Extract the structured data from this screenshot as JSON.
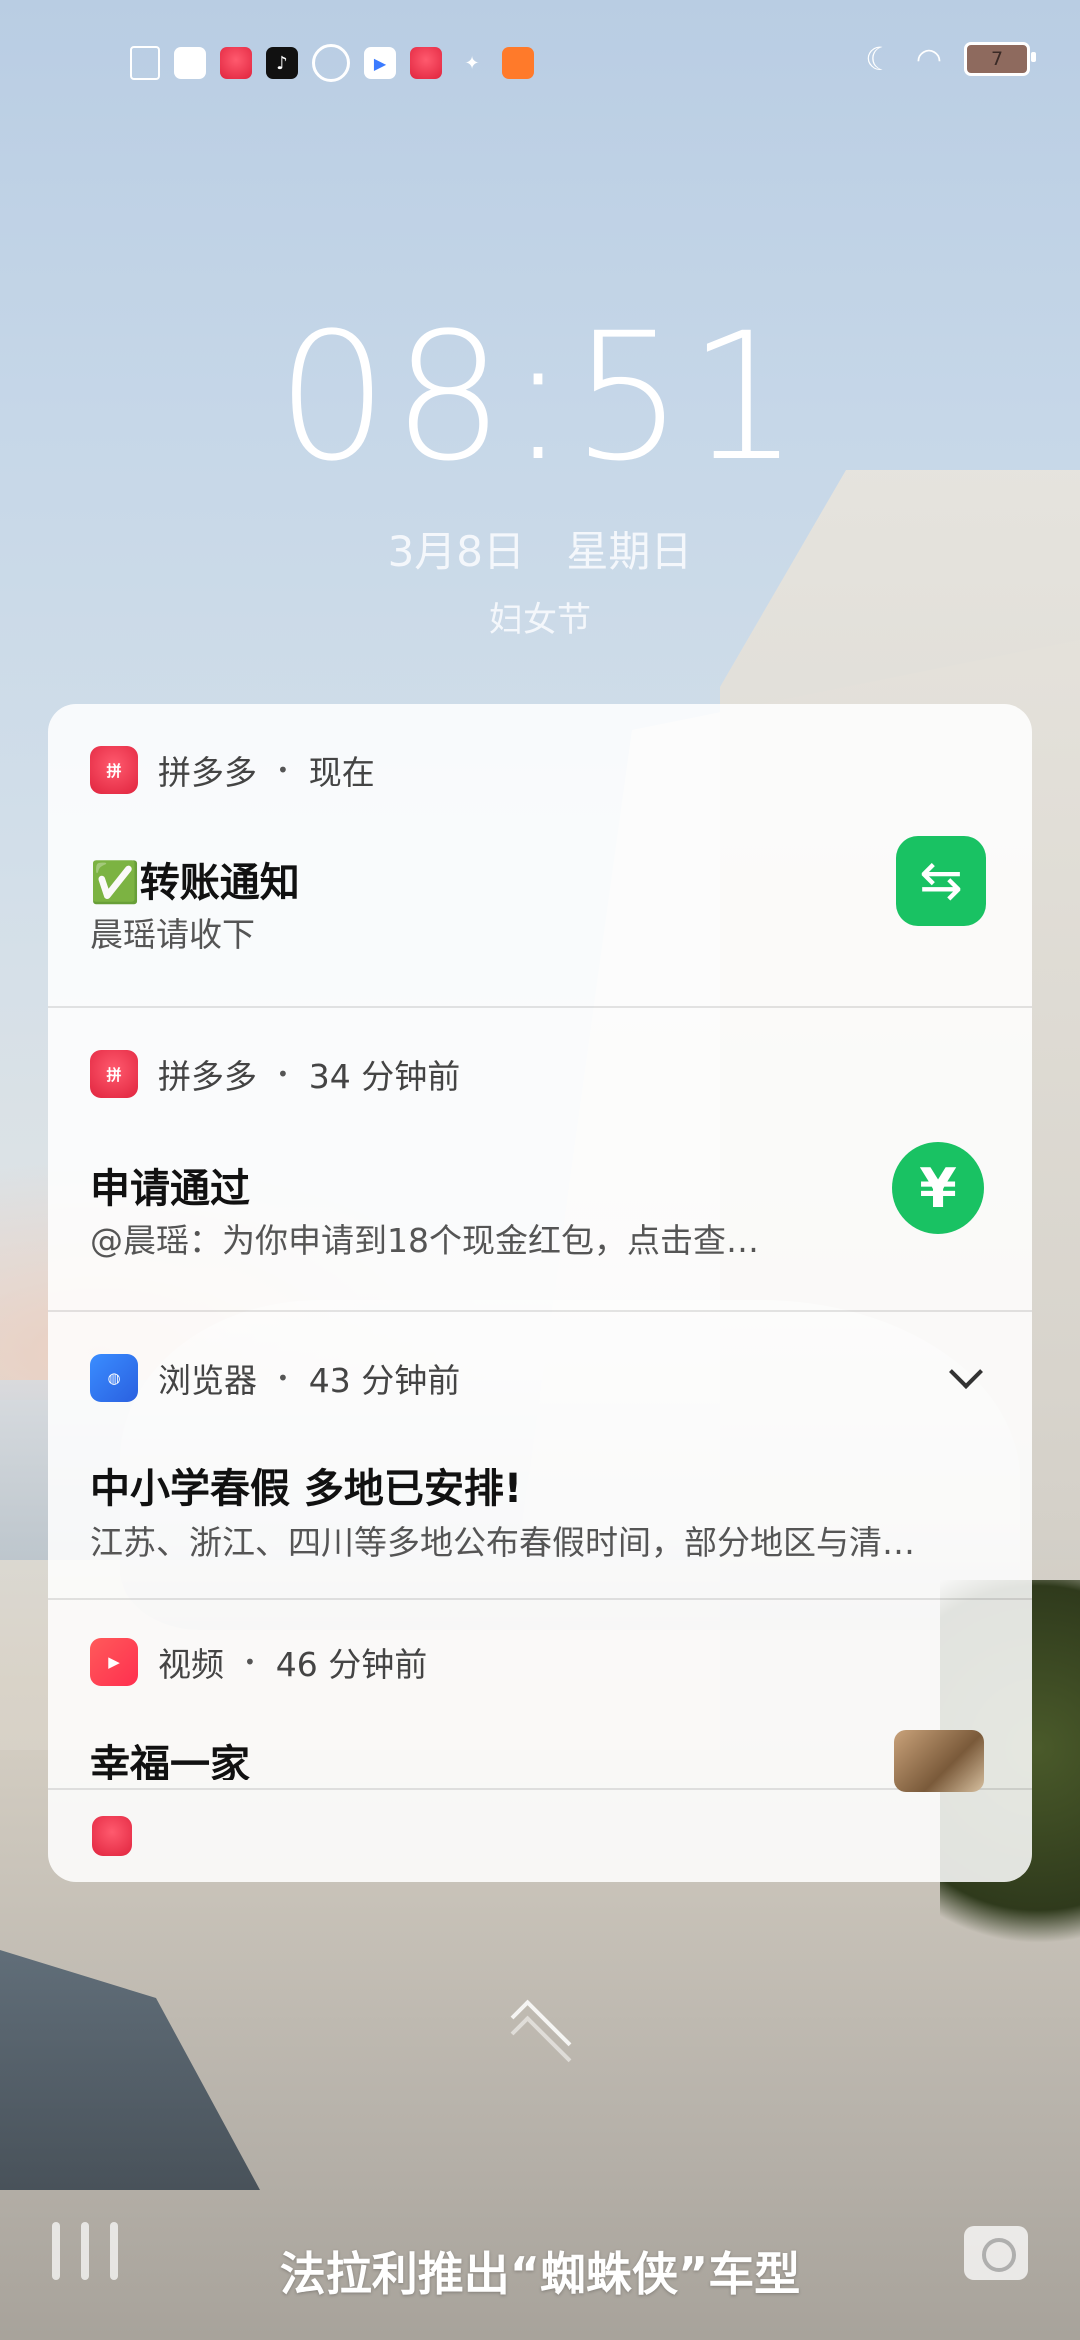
{
  "status_bar": {
    "app_icons": [
      "sim-card-icon",
      "white-square-icon",
      "pinduoduo-38-icon",
      "tiktok-icon",
      "browser-orbit-icon",
      "video-play-icon",
      "store-icon",
      "flame-icon",
      "orange-app-icon"
    ],
    "battery": "7"
  },
  "lockscreen": {
    "time": "08:51",
    "date": "3月8日",
    "weekday": "星期日",
    "festival": "妇女节"
  },
  "notifications": [
    {
      "app": "拼多多",
      "time": "现在",
      "title": "✅转账通知",
      "body": "晨瑶请收下",
      "icon": "pinduoduo-icon",
      "action_icon": "transfer-arrows-icon"
    },
    {
      "app": "拼多多",
      "time": "34 分钟前",
      "title": "申请通过",
      "body": "@晨瑶：为你申请到18个现金红包，点击查…",
      "icon": "pinduoduo-icon",
      "action_icon": "yuan-icon"
    },
    {
      "app": "浏览器",
      "time": "43 分钟前",
      "title": "中小学春假 多地已安排!",
      "body": "江苏、浙江、四川等多地公布春假时间，部分地区与清…",
      "icon": "browser-icon"
    },
    {
      "app": "视频",
      "time": "46 分钟前",
      "title": "幸福一家",
      "icon": "video-icon"
    }
  ],
  "bottom": {
    "headline": "法拉利推出“蜘蛛侠”车型"
  }
}
